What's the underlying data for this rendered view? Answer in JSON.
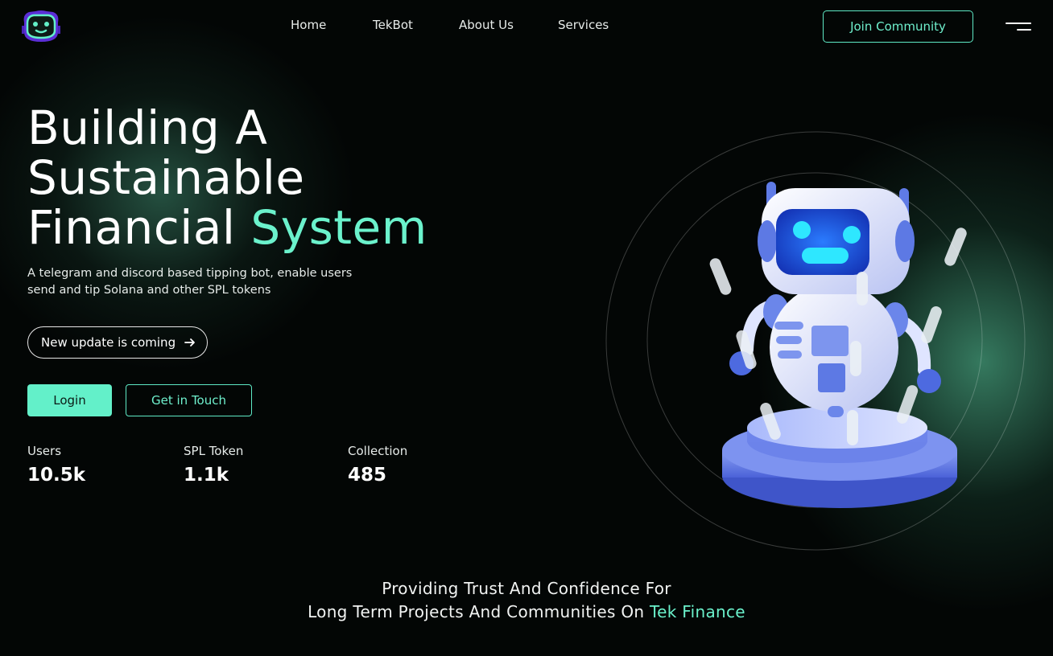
{
  "nav": {
    "items": [
      {
        "label": "Home"
      },
      {
        "label": "TekBot"
      },
      {
        "label": "About Us"
      },
      {
        "label": "Services"
      }
    ],
    "join_label": "Join Community",
    "logo_icon": "robot-face-logo-icon",
    "menu_icon": "hamburger-menu-icon"
  },
  "hero": {
    "line1": "Building A",
    "line2": "Sustainable",
    "line3_plain": "Financial",
    "line3_accent": "System",
    "subtext": "A telegram and discord based tipping bot, enable users send and tip Solana and other SPL tokens",
    "update_label": "New update is coming",
    "login_label": "Login",
    "touch_label": "Get in Touch"
  },
  "stats": [
    {
      "label": "Users",
      "value": "10.5k"
    },
    {
      "label": "SPL Token",
      "value": "1.1k"
    },
    {
      "label": "Collection",
      "value": "485"
    }
  ],
  "tagline": {
    "line1": "Providing Trust And Confidence For",
    "line2_plain": "Long Term Projects And Communities On",
    "line2_accent": "Tek Finance"
  },
  "colors": {
    "accent": "#6bf2cc",
    "background": "#030605"
  }
}
